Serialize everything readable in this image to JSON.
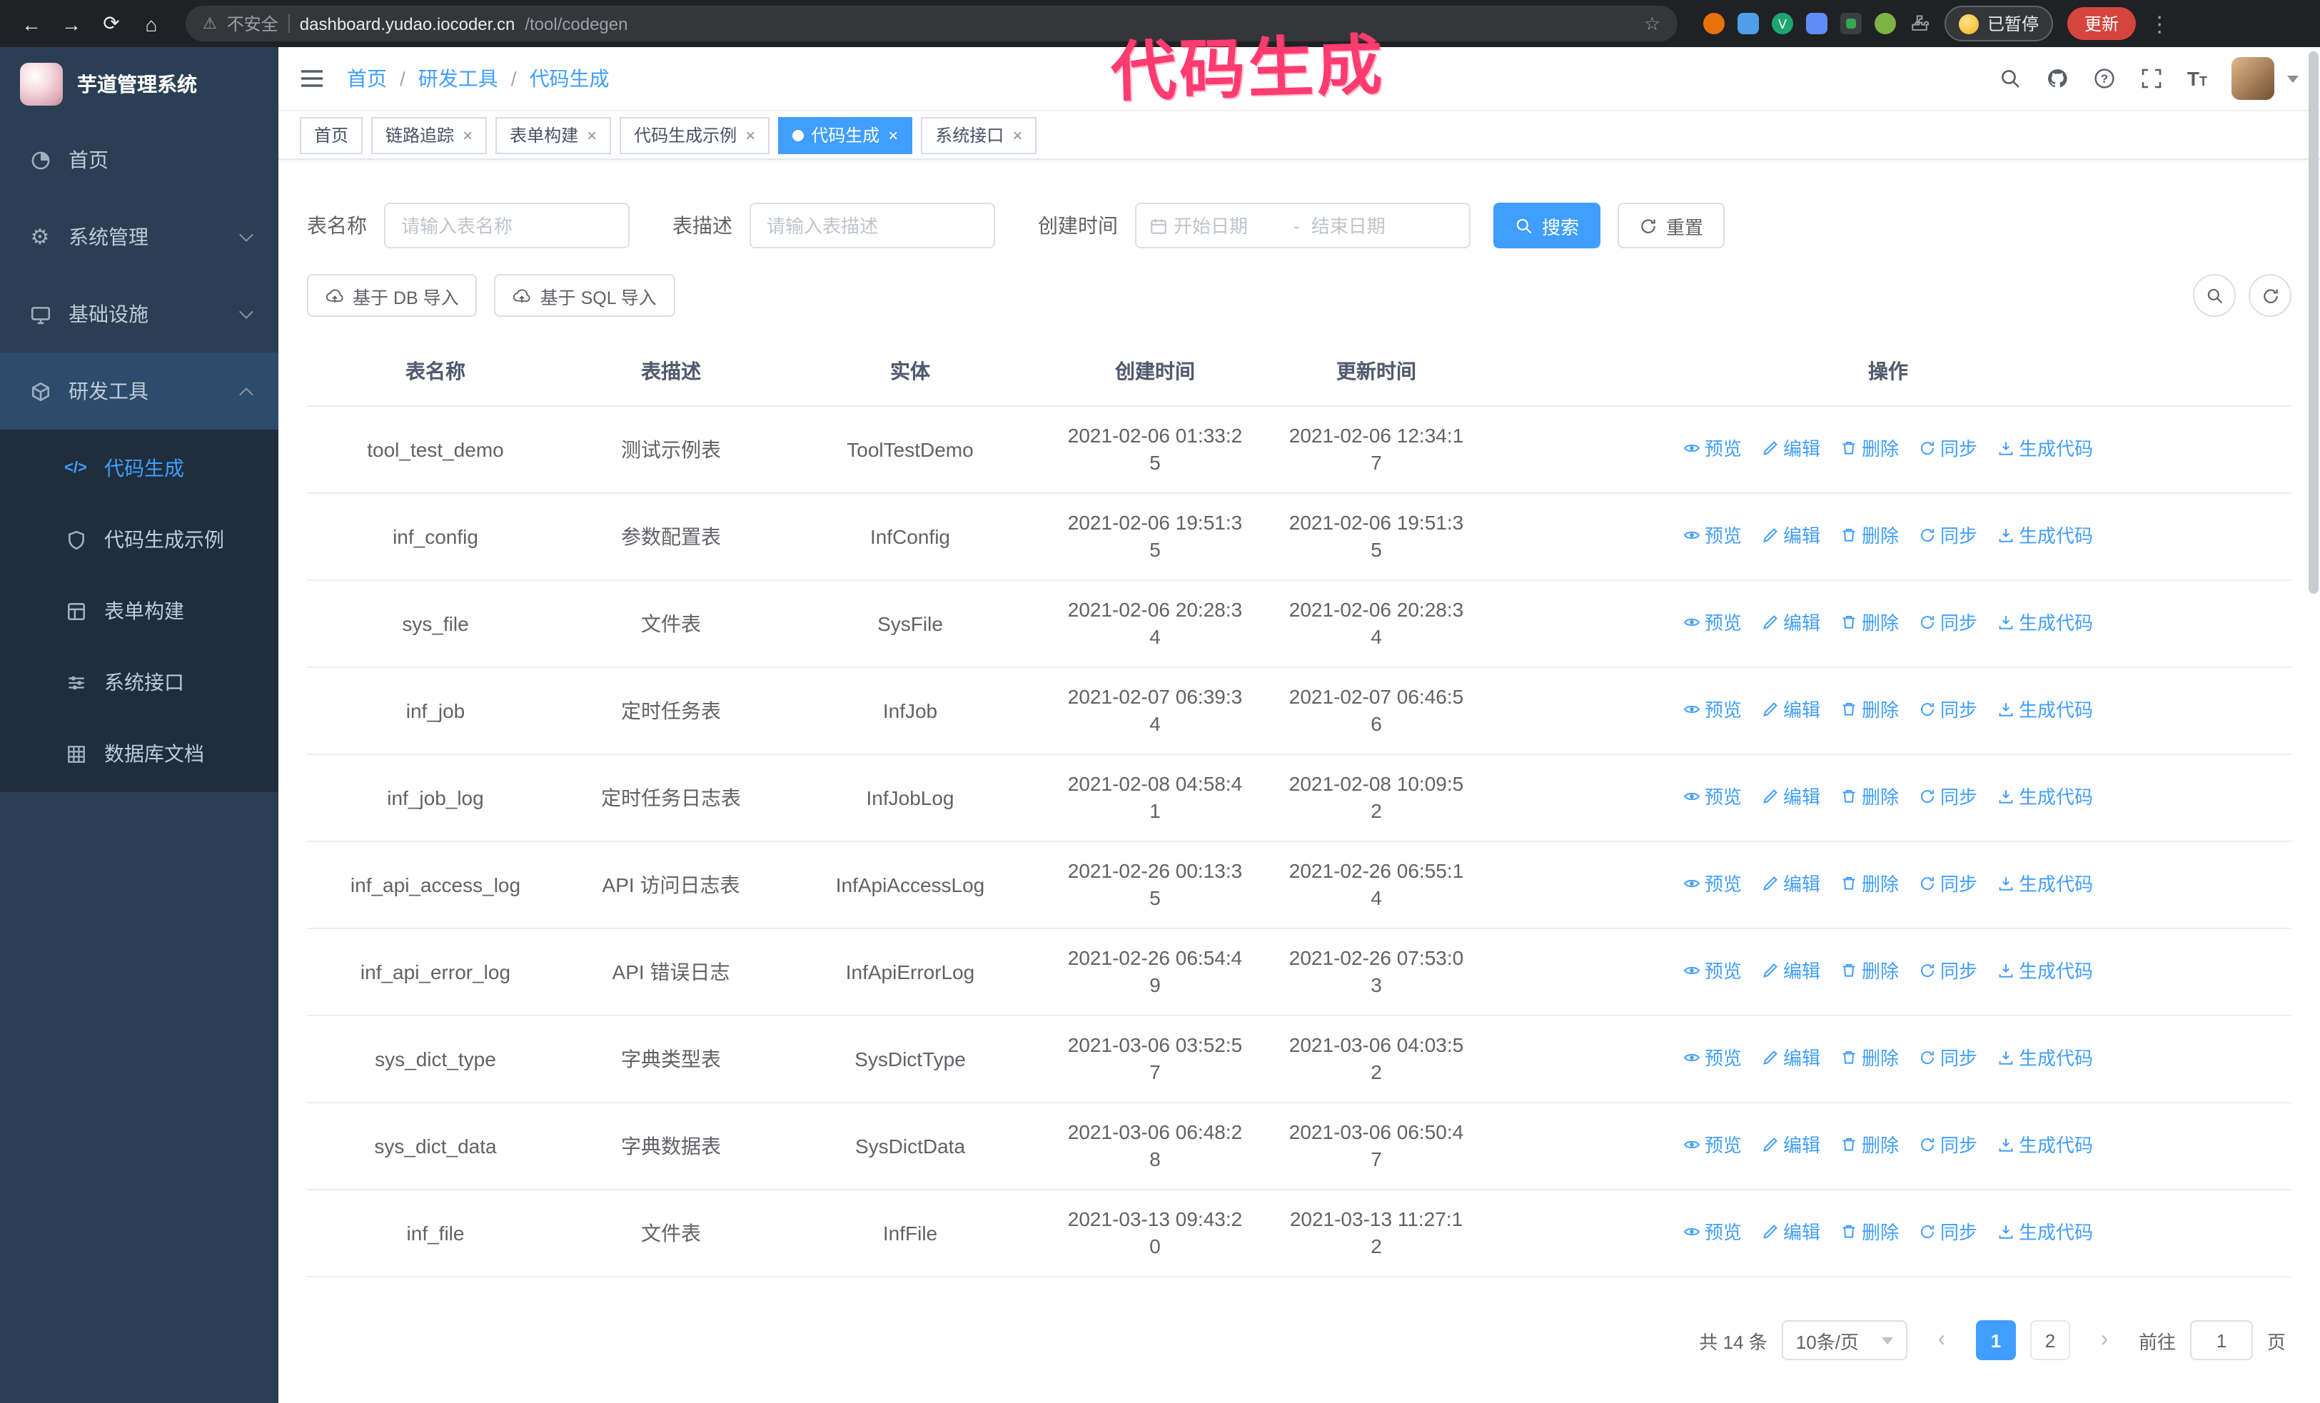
{
  "annotation": {
    "text": "代码生成",
    "color": "#ff3b70"
  },
  "browser": {
    "security_label": "不安全",
    "url_host": "dashboard.yudao.iocoder.cn",
    "url_path": "/tool/codegen",
    "profile_badge": "已暂停",
    "update_button": "更新"
  },
  "sidebar": {
    "title": "芋道管理系统",
    "items": [
      {
        "label": "首页",
        "icon": "dashboard-icon"
      },
      {
        "label": "系统管理",
        "icon": "gear-icon"
      },
      {
        "label": "基础设施",
        "icon": "infrastructure-icon"
      },
      {
        "label": "研发工具",
        "icon": "tools-icon"
      }
    ],
    "submenu": [
      {
        "label": "代码生成",
        "icon": "code-icon",
        "active": true
      },
      {
        "label": "代码生成示例",
        "icon": "shield-icon"
      },
      {
        "label": "表单构建",
        "icon": "form-icon"
      },
      {
        "label": "系统接口",
        "icon": "sliders-icon"
      },
      {
        "label": "数据库文档",
        "icon": "grid-icon"
      }
    ]
  },
  "header": {
    "breadcrumb": [
      "首页",
      "研发工具",
      "代码生成"
    ],
    "separator": "/"
  },
  "tabs": [
    {
      "label": "首页",
      "closable": false,
      "active": false
    },
    {
      "label": "链路追踪",
      "closable": true,
      "active": false
    },
    {
      "label": "表单构建",
      "closable": true,
      "active": false
    },
    {
      "label": "代码生成示例",
      "closable": true,
      "active": false
    },
    {
      "label": "代码生成",
      "closable": true,
      "active": true
    },
    {
      "label": "系统接口",
      "closable": true,
      "active": false
    }
  ],
  "filters": {
    "table_name_label": "表名称",
    "table_name_placeholder": "请输入表名称",
    "table_desc_label": "表描述",
    "table_desc_placeholder": "请输入表描述",
    "create_time_label": "创建时间",
    "date_start_placeholder": "开始日期",
    "date_separator": "-",
    "date_end_placeholder": "结束日期",
    "search_label": "搜索",
    "reset_label": "重置"
  },
  "toolbar": {
    "import_db_label": "基于 DB 导入",
    "import_sql_label": "基于 SQL 导入"
  },
  "table": {
    "columns": [
      "表名称",
      "表描述",
      "实体",
      "创建时间",
      "更新时间",
      "操作"
    ],
    "actions": [
      "预览",
      "编辑",
      "删除",
      "同步",
      "生成代码"
    ],
    "rows": [
      {
        "name": "tool_test_demo",
        "desc": "测试示例表",
        "entity": "ToolTestDemo",
        "created": "2021-02-06 01:33:25",
        "updated": "2021-02-06 12:34:17"
      },
      {
        "name": "inf_config",
        "desc": "参数配置表",
        "entity": "InfConfig",
        "created": "2021-02-06 19:51:35",
        "updated": "2021-02-06 19:51:35"
      },
      {
        "name": "sys_file",
        "desc": "文件表",
        "entity": "SysFile",
        "created": "2021-02-06 20:28:34",
        "updated": "2021-02-06 20:28:34"
      },
      {
        "name": "inf_job",
        "desc": "定时任务表",
        "entity": "InfJob",
        "created": "2021-02-07 06:39:34",
        "updated": "2021-02-07 06:46:56"
      },
      {
        "name": "inf_job_log",
        "desc": "定时任务日志表",
        "entity": "InfJobLog",
        "created": "2021-02-08 04:58:41",
        "updated": "2021-02-08 10:09:52"
      },
      {
        "name": "inf_api_access_log",
        "desc": "API 访问日志表",
        "entity": "InfApiAccessLog",
        "created": "2021-02-26 00:13:35",
        "updated": "2021-02-26 06:55:14"
      },
      {
        "name": "inf_api_error_log",
        "desc": "API 错误日志",
        "entity": "InfApiErrorLog",
        "created": "2021-02-26 06:54:49",
        "updated": "2021-02-26 07:53:03"
      },
      {
        "name": "sys_dict_type",
        "desc": "字典类型表",
        "entity": "SysDictType",
        "created": "2021-03-06 03:52:57",
        "updated": "2021-03-06 04:03:52"
      },
      {
        "name": "sys_dict_data",
        "desc": "字典数据表",
        "entity": "SysDictData",
        "created": "2021-03-06 06:48:28",
        "updated": "2021-03-06 06:50:47"
      },
      {
        "name": "inf_file",
        "desc": "文件表",
        "entity": "InfFile",
        "created": "2021-03-13 09:43:20",
        "updated": "2021-03-13 11:27:12"
      }
    ]
  },
  "pagination": {
    "total": "共 14 条",
    "page_size": "10条/页",
    "pages": [
      "1",
      "2"
    ],
    "active_page": "1",
    "goto_label": "前往",
    "goto_value": "1",
    "goto_suffix": "页"
  }
}
